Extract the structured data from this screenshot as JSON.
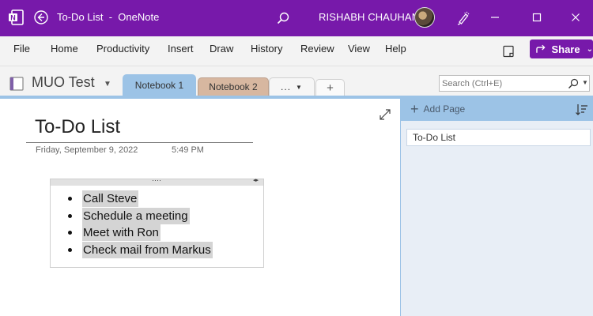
{
  "titlebar": {
    "app_icon": "onenote-logo-icon",
    "title": "To-Do List  -  OneNote",
    "user_name": "RISHABH CHAUHAN"
  },
  "menu": {
    "items": [
      "File",
      "Home",
      "Productivity",
      "Insert",
      "Draw",
      "History",
      "Review",
      "View",
      "Help"
    ],
    "share_label": "Share"
  },
  "notebook": {
    "name": "MUO Test",
    "tabs": [
      {
        "label": "Notebook 1",
        "color": "#9cc3e6",
        "active": true
      },
      {
        "label": "Notebook 2",
        "color": "#d7b7a0",
        "active": false
      },
      {
        "label": "...",
        "color": "#f6f6f6",
        "active": false
      },
      {
        "label": "+",
        "color": "#fafafa",
        "active": false
      }
    ]
  },
  "search": {
    "placeholder": "Search (Ctrl+E)"
  },
  "page": {
    "title": "To-Do List",
    "date": "Friday, September 9, 2022",
    "time": "5:49 PM",
    "todo_items": [
      "Call Steve",
      "Schedule a meeting",
      "Meet with Ron",
      "Check mail from Markus"
    ]
  },
  "pages_pane": {
    "add_page_label": "Add Page",
    "pages": [
      "To-Do List"
    ]
  },
  "colors": {
    "titlebar": "#7719aa",
    "accent_blue": "#9cc3e6",
    "highlight": "#d4d4d4"
  }
}
